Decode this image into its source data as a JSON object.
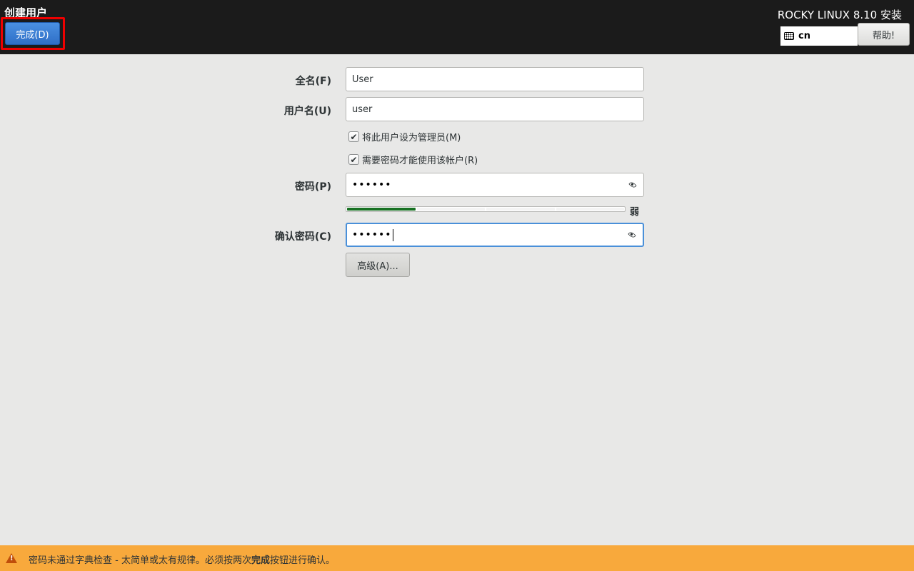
{
  "header": {
    "page_title": "创建用户",
    "done_label": "完成(D)",
    "product_title": "ROCKY LINUX 8.10 安装",
    "keyboard_layout": "cn",
    "help_label": "帮助!"
  },
  "form": {
    "fullname_label": "全名(F)",
    "fullname_value": "User",
    "username_label": "用户名(U)",
    "username_value": "user",
    "admin_checkbox_label": "将此用户设为管理员(M)",
    "admin_checked": true,
    "require_password_label": "需要密码才能使用该帐户(R)",
    "require_password_checked": true,
    "password_label": "密码(P)",
    "password_value": "••••••",
    "strength_label": "弱",
    "strength_fraction": 0.25,
    "confirm_label": "确认密码(C)",
    "confirm_value": "••••••",
    "advanced_label": "高级(A)..."
  },
  "warning": {
    "text_before": "密码未通过字典检查 - 太简单或太有规律。必须按两次",
    "text_bold": "完成",
    "text_after": "按钮进行确认。"
  },
  "colors": {
    "header_bg": "#1b1b1b",
    "done_button": "#3b80d8",
    "highlight": "#ee0000",
    "strength_fill": "#177022",
    "warning_bg": "#f8a93c"
  }
}
